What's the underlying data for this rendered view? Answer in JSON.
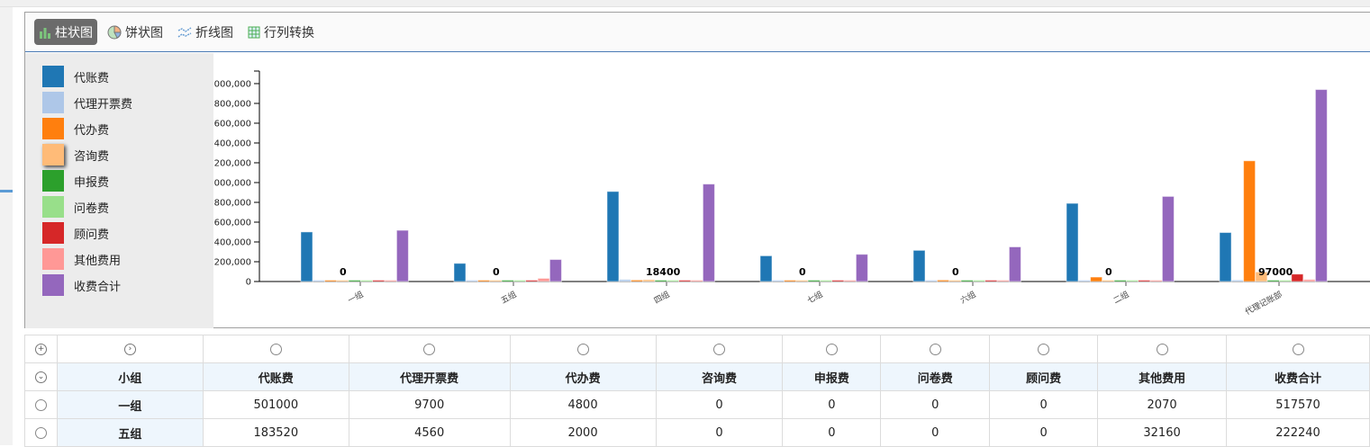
{
  "toolbar": {
    "buttons": [
      {
        "label": "柱状图",
        "icon": "bar-chart-icon",
        "active": true
      },
      {
        "label": "饼状图",
        "icon": "pie-chart-icon",
        "active": false
      },
      {
        "label": "折线图",
        "icon": "line-chart-icon",
        "active": false
      },
      {
        "label": "行列转换",
        "icon": "table-transpose-icon",
        "active": false
      }
    ]
  },
  "chart_data": {
    "type": "bar",
    "categories": [
      "一组",
      "五组",
      "四组",
      "七组",
      "六组",
      "二组",
      "代理记账部"
    ],
    "series": [
      {
        "name": "代账费",
        "color": "#1f77b4",
        "values": [
          501000,
          183520,
          910000,
          260000,
          315000,
          790000,
          495000
        ]
      },
      {
        "name": "代理开票费",
        "color": "#aec7e8",
        "values": [
          9700,
          4560,
          20000,
          3000,
          5000,
          10000,
          15000
        ]
      },
      {
        "name": "代办费",
        "color": "#ff7f0e",
        "values": [
          4800,
          2000,
          15000,
          2000,
          15000,
          45000,
          1220000
        ]
      },
      {
        "name": "咨询费",
        "color": "#ffbb78",
        "values": [
          0,
          0,
          18400,
          0,
          0,
          0,
          97000
        ]
      },
      {
        "name": "申报费",
        "color": "#2ca02c",
        "values": [
          0,
          0,
          0,
          0,
          0,
          0,
          5000
        ]
      },
      {
        "name": "问卷费",
        "color": "#98df8a",
        "values": [
          0,
          0,
          0,
          0,
          0,
          0,
          10000
        ]
      },
      {
        "name": "顾问费",
        "color": "#d62728",
        "values": [
          0,
          0,
          0,
          0,
          0,
          0,
          75000
        ]
      },
      {
        "name": "其他费用",
        "color": "#ff9896",
        "values": [
          2070,
          32160,
          5000,
          2000,
          3000,
          5000,
          20000
        ]
      },
      {
        "name": "收费合计",
        "color": "#9467bd",
        "values": [
          517570,
          222240,
          985000,
          275000,
          350000,
          860000,
          1940000
        ]
      }
    ],
    "data_labels": [
      "0",
      "0",
      "18400",
      "0",
      "0",
      "0",
      "97000"
    ],
    "yticks": [
      0,
      200000,
      400000,
      600000,
      800000,
      1000000,
      1200000,
      1400000,
      1600000,
      1800000,
      2000000
    ],
    "ytick_labels": [
      "0",
      "200,000",
      "400,000",
      "600,000",
      "800,000",
      "000,000",
      "200,000",
      "400,000",
      "600,000",
      "800,000",
      "000,000"
    ],
    "ylim": [
      0,
      2127000
    ],
    "legend": "left"
  },
  "table": {
    "headers": [
      "小组",
      "代账费",
      "代理开票费",
      "代办费",
      "咨询费",
      "申报费",
      "问卷费",
      "顾问费",
      "其他费用",
      "收费合计"
    ],
    "rows": [
      [
        "一组",
        "501000",
        "9700",
        "4800",
        "0",
        "0",
        "0",
        "0",
        "2070",
        "517570"
      ],
      [
        "五组",
        "183520",
        "4560",
        "2000",
        "0",
        "0",
        "0",
        "0",
        "32160",
        "222240"
      ]
    ]
  }
}
